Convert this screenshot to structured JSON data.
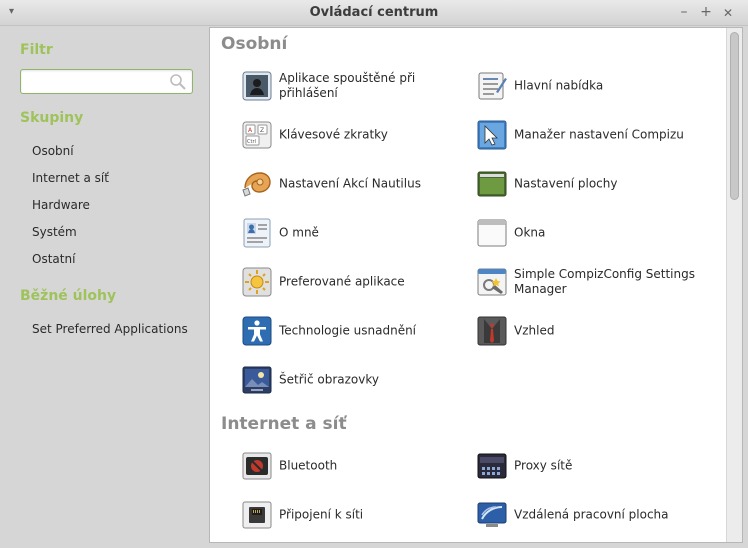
{
  "window": {
    "title": "Ovládací centrum",
    "menu_glyph": "▾",
    "minimize_glyph": "–",
    "maximize_glyph": "+",
    "close_glyph": "✕"
  },
  "sidebar": {
    "filter_heading": "Filtr",
    "search": {
      "value": "",
      "placeholder": ""
    },
    "groups_heading": "Skupiny",
    "groups": [
      "Osobní",
      "Internet a síť",
      "Hardware",
      "Systém",
      "Ostatní"
    ],
    "tasks_heading": "Běžné úlohy",
    "tasks": [
      "Set Preferred Applications"
    ]
  },
  "content": {
    "sections": [
      {
        "title": "Osobní",
        "items": [
          {
            "label": "Aplikace spouštěné při přihlášení",
            "icon": "startup-applications-icon"
          },
          {
            "label": "Hlavní nabídka",
            "icon": "main-menu-icon"
          },
          {
            "label": "Klávesové zkratky",
            "icon": "keyboard-shortcuts-icon"
          },
          {
            "label": "Manažer nastavení Compizu",
            "icon": "compiz-settings-icon"
          },
          {
            "label": "Nastavení Akcí Nautilus",
            "icon": "nautilus-actions-icon"
          },
          {
            "label": "Nastavení plochy",
            "icon": "desktop-settings-icon"
          },
          {
            "label": "O mně",
            "icon": "about-me-icon"
          },
          {
            "label": "Okna",
            "icon": "windows-icon"
          },
          {
            "label": "Preferované aplikace",
            "icon": "preferred-apps-icon"
          },
          {
            "label": "Simple CompizConfig Settings Manager",
            "icon": "simple-ccsm-icon"
          },
          {
            "label": "Technologie usnadnění",
            "icon": "accessibility-icon"
          },
          {
            "label": "Vzhled",
            "icon": "appearance-icon"
          },
          {
            "label": "Šetřič obrazovky",
            "icon": "screensaver-icon"
          }
        ]
      },
      {
        "title": "Internet a síť",
        "items": [
          {
            "label": "Bluetooth",
            "icon": "bluetooth-icon"
          },
          {
            "label": "Proxy sítě",
            "icon": "network-proxy-icon"
          },
          {
            "label": "Připojení k síti",
            "icon": "network-connections-icon"
          },
          {
            "label": "Vzdálená pracovní plocha",
            "icon": "remote-desktop-icon"
          }
        ]
      }
    ]
  },
  "colors": {
    "accent_green": "#9fc35b",
    "section_gray": "#8c8c8c"
  }
}
